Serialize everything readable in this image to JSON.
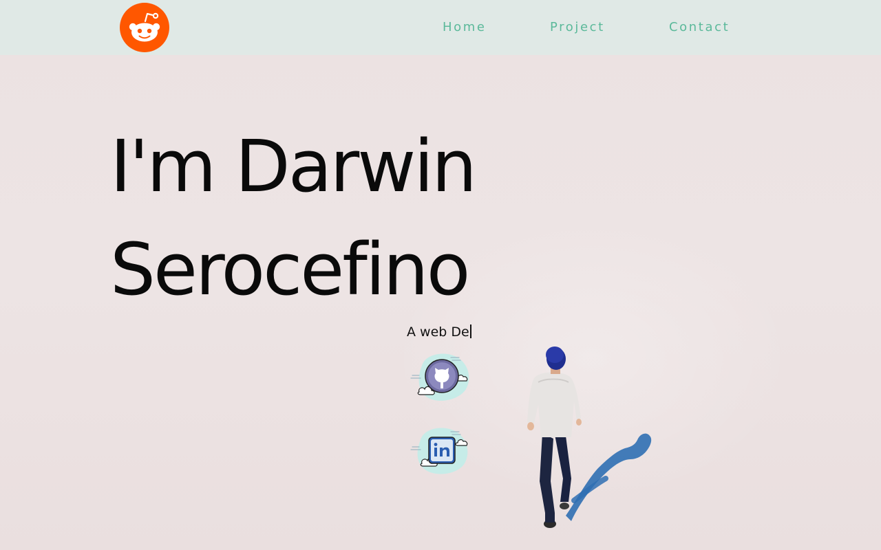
{
  "header": {
    "logo_icon": "reddit-alien-icon",
    "nav": [
      {
        "label": "Home"
      },
      {
        "label": "Project"
      },
      {
        "label": "Contact"
      }
    ]
  },
  "hero": {
    "line1": "I'm Darwin",
    "line2": "Serocefino",
    "tagline": "A web De"
  },
  "social": [
    {
      "icon": "github-octocat-icon"
    },
    {
      "icon": "linkedin-icon"
    }
  ],
  "colors": {
    "header_bg": "#e0e9e6",
    "page_bg": "#ece3e3",
    "logo_orange": "#ff5700",
    "nav_text": "#5bb99a",
    "hero_text": "#0a0a0a"
  }
}
